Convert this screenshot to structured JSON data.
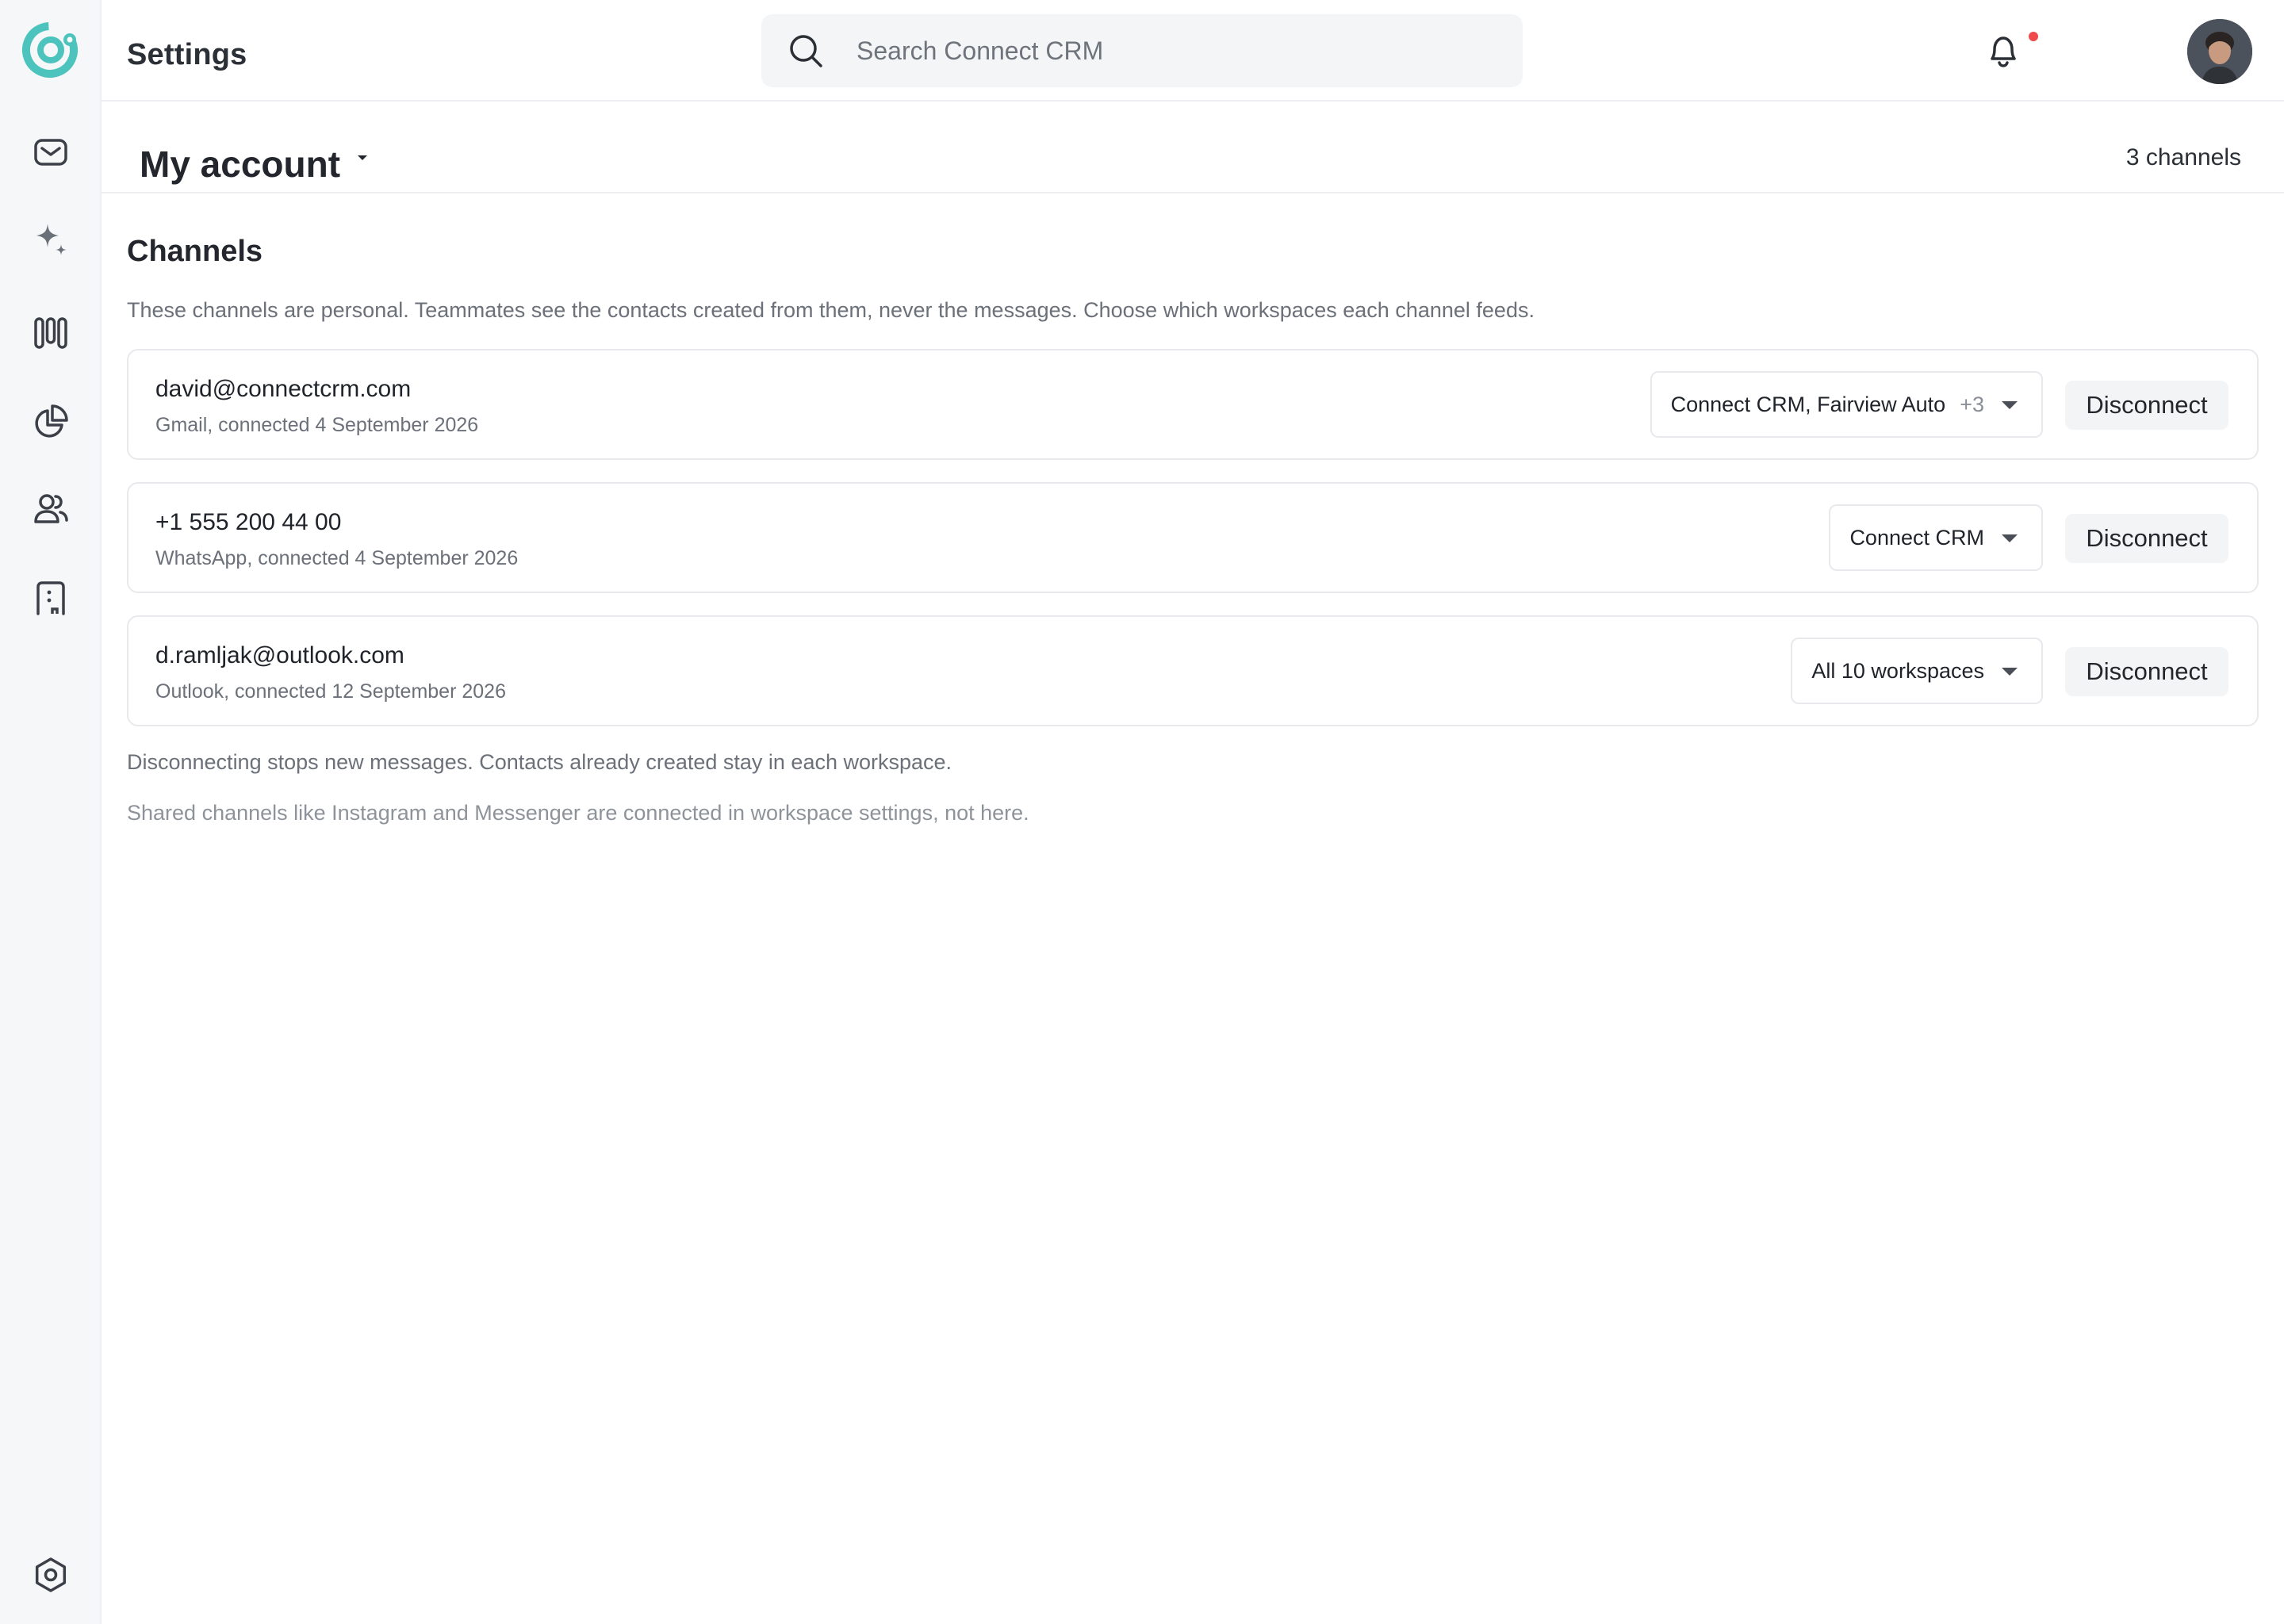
{
  "app": {
    "name": "Connect CRM"
  },
  "header": {
    "page_title": "Settings",
    "search_placeholder": "Search Connect CRM"
  },
  "sidebar": {
    "items": [
      {
        "name": "inbox",
        "icon": "mail-icon"
      },
      {
        "name": "ai",
        "icon": "sparkle-icon"
      },
      {
        "name": "pipeline",
        "icon": "columns-icon"
      },
      {
        "name": "reports",
        "icon": "pie-chart-icon"
      },
      {
        "name": "contacts",
        "icon": "users-icon"
      },
      {
        "name": "companies",
        "icon": "building-icon"
      }
    ],
    "bottom_item": {
      "name": "settings",
      "icon": "settings-icon"
    }
  },
  "account": {
    "title": "My account",
    "channel_count": "3 channels"
  },
  "channels": {
    "title": "Channels",
    "description": "These channels are personal. Teammates see the contacts created from them, never the messages. Choose which workspaces each channel feeds.",
    "disconnect_label": "Disconnect",
    "items": [
      {
        "id": "david@connectcrm.com",
        "subtitle": "Gmail, connected 4 September 2026",
        "workspaces": "Connect CRM, Fairview Auto",
        "more": "+3"
      },
      {
        "id": "+1 555 200 44 00",
        "subtitle": "WhatsApp, connected 4 September 2026",
        "workspaces": "Connect CRM",
        "more": ""
      },
      {
        "id": "d.ramljak@outlook.com",
        "subtitle": "Outlook, connected 12 September 2026",
        "workspaces": "All 10 workspaces",
        "more": ""
      }
    ],
    "note_disconnect": "Disconnecting stops new messages. Contacts already created stay in each workspace.",
    "note_shared": "Shared channels like Instagram and Messenger are connected in workspace settings, not here."
  },
  "colors": {
    "brand": "#4cc3bd",
    "notification": "#ef4b4b",
    "text": "#1f2329",
    "muted": "#6b7079"
  }
}
